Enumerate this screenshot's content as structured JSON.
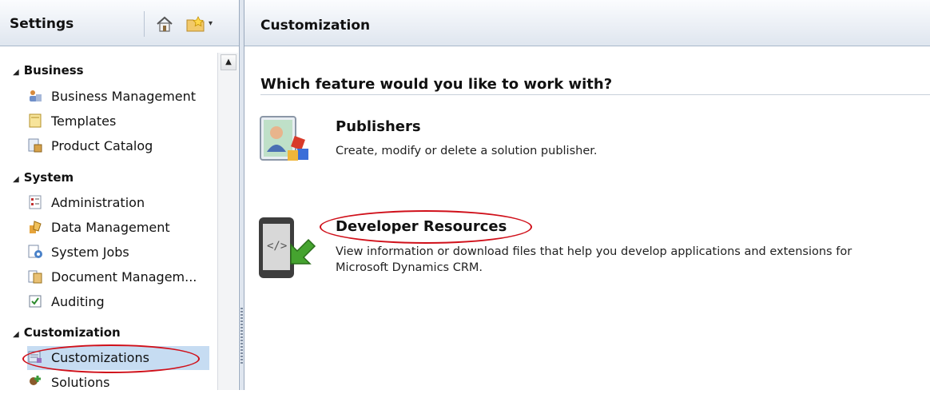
{
  "nav": {
    "title": "Settings",
    "groups": [
      {
        "label": "Business",
        "items": [
          {
            "label": "Business Management",
            "icon": "business-management-icon"
          },
          {
            "label": "Templates",
            "icon": "templates-icon"
          },
          {
            "label": "Product Catalog",
            "icon": "product-catalog-icon"
          }
        ]
      },
      {
        "label": "System",
        "items": [
          {
            "label": "Administration",
            "icon": "administration-icon"
          },
          {
            "label": "Data Management",
            "icon": "data-management-icon"
          },
          {
            "label": "System Jobs",
            "icon": "system-jobs-icon"
          },
          {
            "label": "Document Managem...",
            "icon": "document-management-icon"
          },
          {
            "label": "Auditing",
            "icon": "auditing-icon"
          }
        ]
      },
      {
        "label": "Customization",
        "items": [
          {
            "label": "Customizations",
            "icon": "customizations-icon",
            "selected": true
          },
          {
            "label": "Solutions",
            "icon": "solutions-icon"
          }
        ]
      }
    ]
  },
  "main": {
    "title": "Customization",
    "question": "Which feature would you like to work with?",
    "features": [
      {
        "title": "Publishers",
        "description": "Create, modify or delete a solution publisher.",
        "icon": "publishers-icon"
      },
      {
        "title": "Developer Resources",
        "description_line1": "View information or download files that help you develop applications and extensions for",
        "description_line2": "Microsoft Dynamics CRM.",
        "icon": "developer-resources-icon"
      }
    ]
  },
  "colors": {
    "header_gradient_top": "#fbfcfe",
    "header_gradient_bottom": "#dfe6ef",
    "selected_item": "#c6dcf2",
    "annotation_red": "#d0101a"
  }
}
